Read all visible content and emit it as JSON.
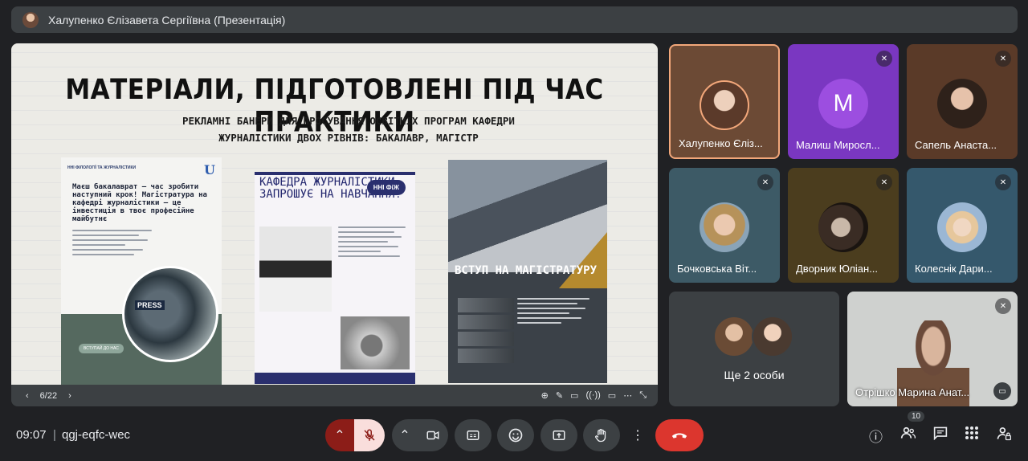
{
  "topbar": {
    "title": "Халупенко Єлізавета Сергіївна (Презентація)"
  },
  "slide": {
    "title": "МАТЕРІАЛИ, ПІДГОТОВЛЕНІ ПІД ЧАС ПРАКТИКИ",
    "subtitle_line1": "РЕКЛАМНІ БАНЕРИ ДЛЯ ПРОСУВАННЯ ОСВІТНІХ ПРОГРАМ КАФЕДРИ",
    "subtitle_line2": "ЖУРНАЛІСТИКИ ДВОХ РІВНІВ: БАКАЛАВР, МАГІСТР",
    "poster1": {
      "brand": "ННІ ФІЛОЛОГІЇ ТА ЖУРНАЛІСТИКИ",
      "logo": "U",
      "headline": "Маєш бакалаврат — час зробити наступний крок! Магістратура на кафедрі журналістики — це інвестиція в твоє професійне майбутнє",
      "badge": "PRESS",
      "button": "ВСТУПАЙ ДО НАС"
    },
    "poster2": {
      "headline": "КАФЕДРА ЖУРНАЛІСТИКИ ЗАПРОШУЄ НА НАВЧАННЯ!",
      "pill": "ННІ ФіЖ"
    },
    "poster3": {
      "headline": "ВСТУП НА МАГІСТРАТУРУ"
    }
  },
  "slide_bar": {
    "prev": "‹",
    "page": "6/22",
    "next": "›",
    "tools": [
      "⊕",
      "✎",
      "▭",
      "((·))",
      "▭",
      "⋯",
      "⤡"
    ]
  },
  "tiles": [
    {
      "name": "Халупенко Єліз..."
    },
    {
      "name": "Малиш Миросл...",
      "initial": "M"
    },
    {
      "name": "Сапель Анаста..."
    },
    {
      "name": "Бочковська Віт..."
    },
    {
      "name": "Дворник Юліан..."
    },
    {
      "name": "Колеснік Дари..."
    },
    {
      "name": "Ще 2 особи"
    },
    {
      "name": "Отрішко Марина Анат..."
    }
  ],
  "bottom": {
    "time": "09:07",
    "separator": "|",
    "meeting_code": "qgj-eqfc-wec",
    "participants_count": "10"
  },
  "colors": {
    "background": "#202124",
    "end_call": "#dc362e",
    "mic_off_bg": "#f9dedc"
  }
}
